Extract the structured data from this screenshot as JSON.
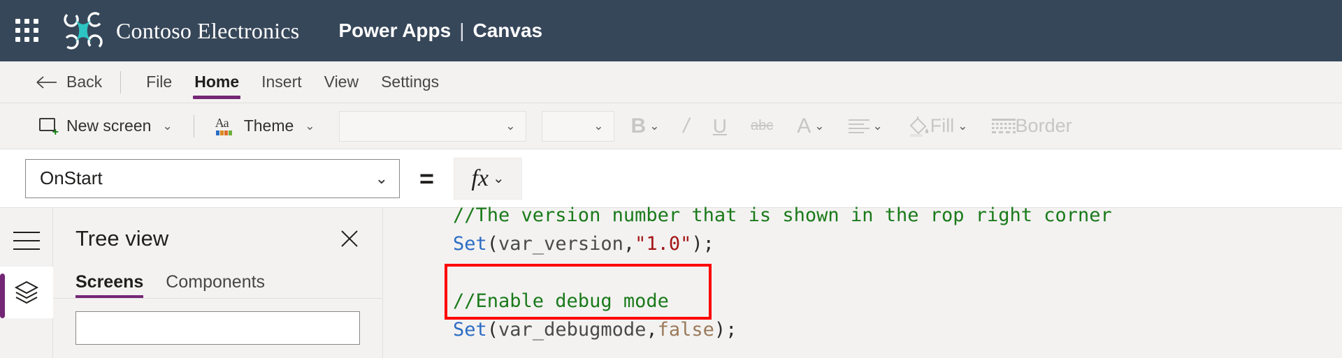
{
  "titlebar": {
    "waffle_icon": "app-launcher-icon",
    "brand_logo_icon": "drone-logo-icon",
    "brand_name": "Contoso Electronics",
    "app_name": "Power Apps",
    "separator": "|",
    "app_mode": "Canvas",
    "bg_color": "#37475a"
  },
  "menubar": {
    "back_label": "Back",
    "back_icon": "arrow-left-icon",
    "items": [
      {
        "label": "File",
        "active": false
      },
      {
        "label": "Home",
        "active": true
      },
      {
        "label": "Insert",
        "active": false
      },
      {
        "label": "View",
        "active": false
      },
      {
        "label": "Settings",
        "active": false
      }
    ],
    "accent_color": "#742774"
  },
  "toolbar": {
    "new_screen_label": "New screen",
    "new_screen_icon": "new-screen-icon",
    "theme_label": "Theme",
    "theme_icon": "theme-aa-icon",
    "caret": "⌄",
    "font_family_value": "",
    "font_size_value": "",
    "bold_label": "B",
    "italic_label": "/",
    "underline_label": "U",
    "strikethrough_label": "abc",
    "font_color_label": "A",
    "align_icon": "align-left-icon",
    "fill_label": "Fill",
    "fill_icon": "paint-bucket-icon",
    "border_label": "Border",
    "border_icon": "border-dashed-icon"
  },
  "formulabar": {
    "property_value": "OnStart",
    "equals": "=",
    "fx_label": "fx",
    "caret": "⌄"
  },
  "code": {
    "lines": [
      [
        {
          "t": "//The version number that is shown in the rop right corner",
          "c": "cm"
        }
      ],
      [
        {
          "t": "Set",
          "c": "cfn"
        },
        {
          "t": "(",
          "c": "cpun"
        },
        {
          "t": "var_version",
          "c": "cid"
        },
        {
          "t": ",",
          "c": "cpun"
        },
        {
          "t": "\"1.0\"",
          "c": "cstr"
        },
        {
          "t": ");",
          "c": "cpun"
        }
      ],
      [
        {
          "t": "",
          "c": "cpun"
        }
      ],
      [
        {
          "t": "//Enable debug mode",
          "c": "cm"
        }
      ],
      [
        {
          "t": "Set",
          "c": "cfn"
        },
        {
          "t": "(",
          "c": "cpun"
        },
        {
          "t": "var_debugmode",
          "c": "cid"
        },
        {
          "t": ",",
          "c": "cpun"
        },
        {
          "t": "false",
          "c": "cbool"
        },
        {
          "t": ");",
          "c": "cpun"
        }
      ]
    ],
    "highlight_color": "#ff0000",
    "comment_color": "#1a7a1a",
    "function_color": "#2b6cc4",
    "string_color": "#a31515"
  },
  "rail": {
    "menu_icon": "hamburger-menu-icon",
    "tree_view_icon": "layers-icon"
  },
  "panel": {
    "title": "Tree view",
    "close_icon": "close-icon",
    "tabs": [
      {
        "label": "Screens",
        "active": true
      },
      {
        "label": "Components",
        "active": false
      }
    ]
  }
}
